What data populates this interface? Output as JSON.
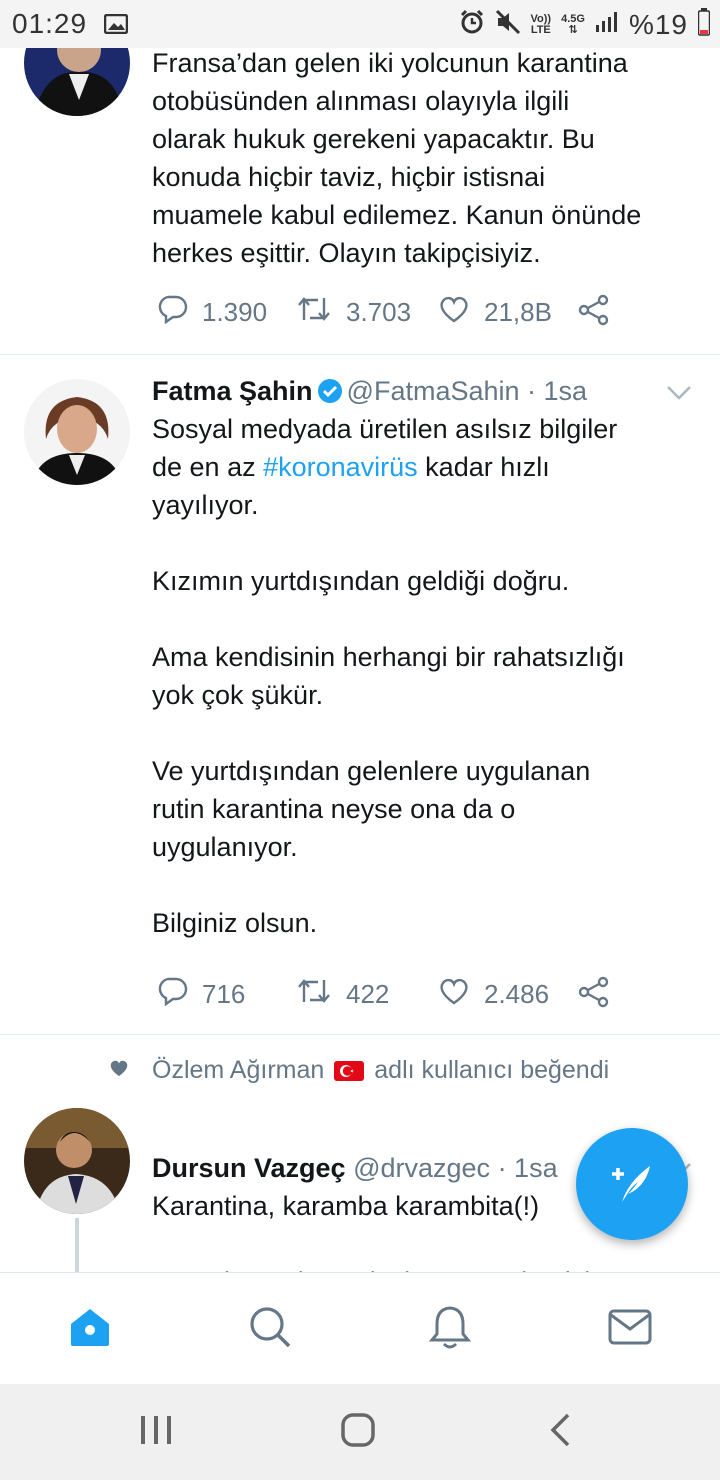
{
  "status_bar": {
    "time": "01:29",
    "battery_percent": "%19",
    "network_label_1": "Vo))",
    "network_label_2": "LTE",
    "network_label_3": "4.5G",
    "icons": [
      "image-icon",
      "alarm-icon",
      "mute-icon",
      "signal-icon",
      "battery-icon"
    ]
  },
  "tweets": [
    {
      "text": "Fransa’dan gelen iki yolcunun karantina\notobüsünden alınması olayıyla ilgili\nolarak hukuk gerekeni yapacaktır. Bu\nkonuda hiçbir taviz, hiçbir istisnai\nmuamele kabul edilemez. Kanun önünde\nherkes eşittir. Olayın takipçisiyiz.",
      "replies": "1.390",
      "retweets": "3.703",
      "likes": "21,8B"
    },
    {
      "name": "Fatma Şahin",
      "handle": "@FatmaSahin",
      "time": "· 1sa",
      "text_before": "Sosyal medyada üretilen asılsız bilgiler\nde en az ",
      "hashtag": "#koronavirüs",
      "text_after": " kadar hızlı\nyayılıyor.\n\nKızımın yurtdışından geldiği doğru.\n\nAma kendisinin herhangi bir rahatsızlığı\nyok çok şükür.\n\nVe yurtdışından gelenlere uygulanan\nrutin karantina neyse ona da o\nuygulanıyor.\n\nBilginiz olsun.",
      "replies": "716",
      "retweets": "422",
      "likes": "2.486"
    },
    {
      "social_context_user": "Özlem Ağırman",
      "social_context_text": "adlı kullanıcı beğendi",
      "name": "Dursun Vazgeç",
      "handle": "@drvazgec",
      "time": "· 1sa",
      "text": "Karantina, karamba karambita(!)\n\nABD den gelen yolcular Karantina için\nyola çıkıyor..."
    }
  ],
  "tabs": [
    "home-icon",
    "search-icon",
    "notifications-icon",
    "messages-icon"
  ],
  "colors": {
    "accent": "#1da1f2",
    "text": "#14171a",
    "secondary": "#657786"
  }
}
